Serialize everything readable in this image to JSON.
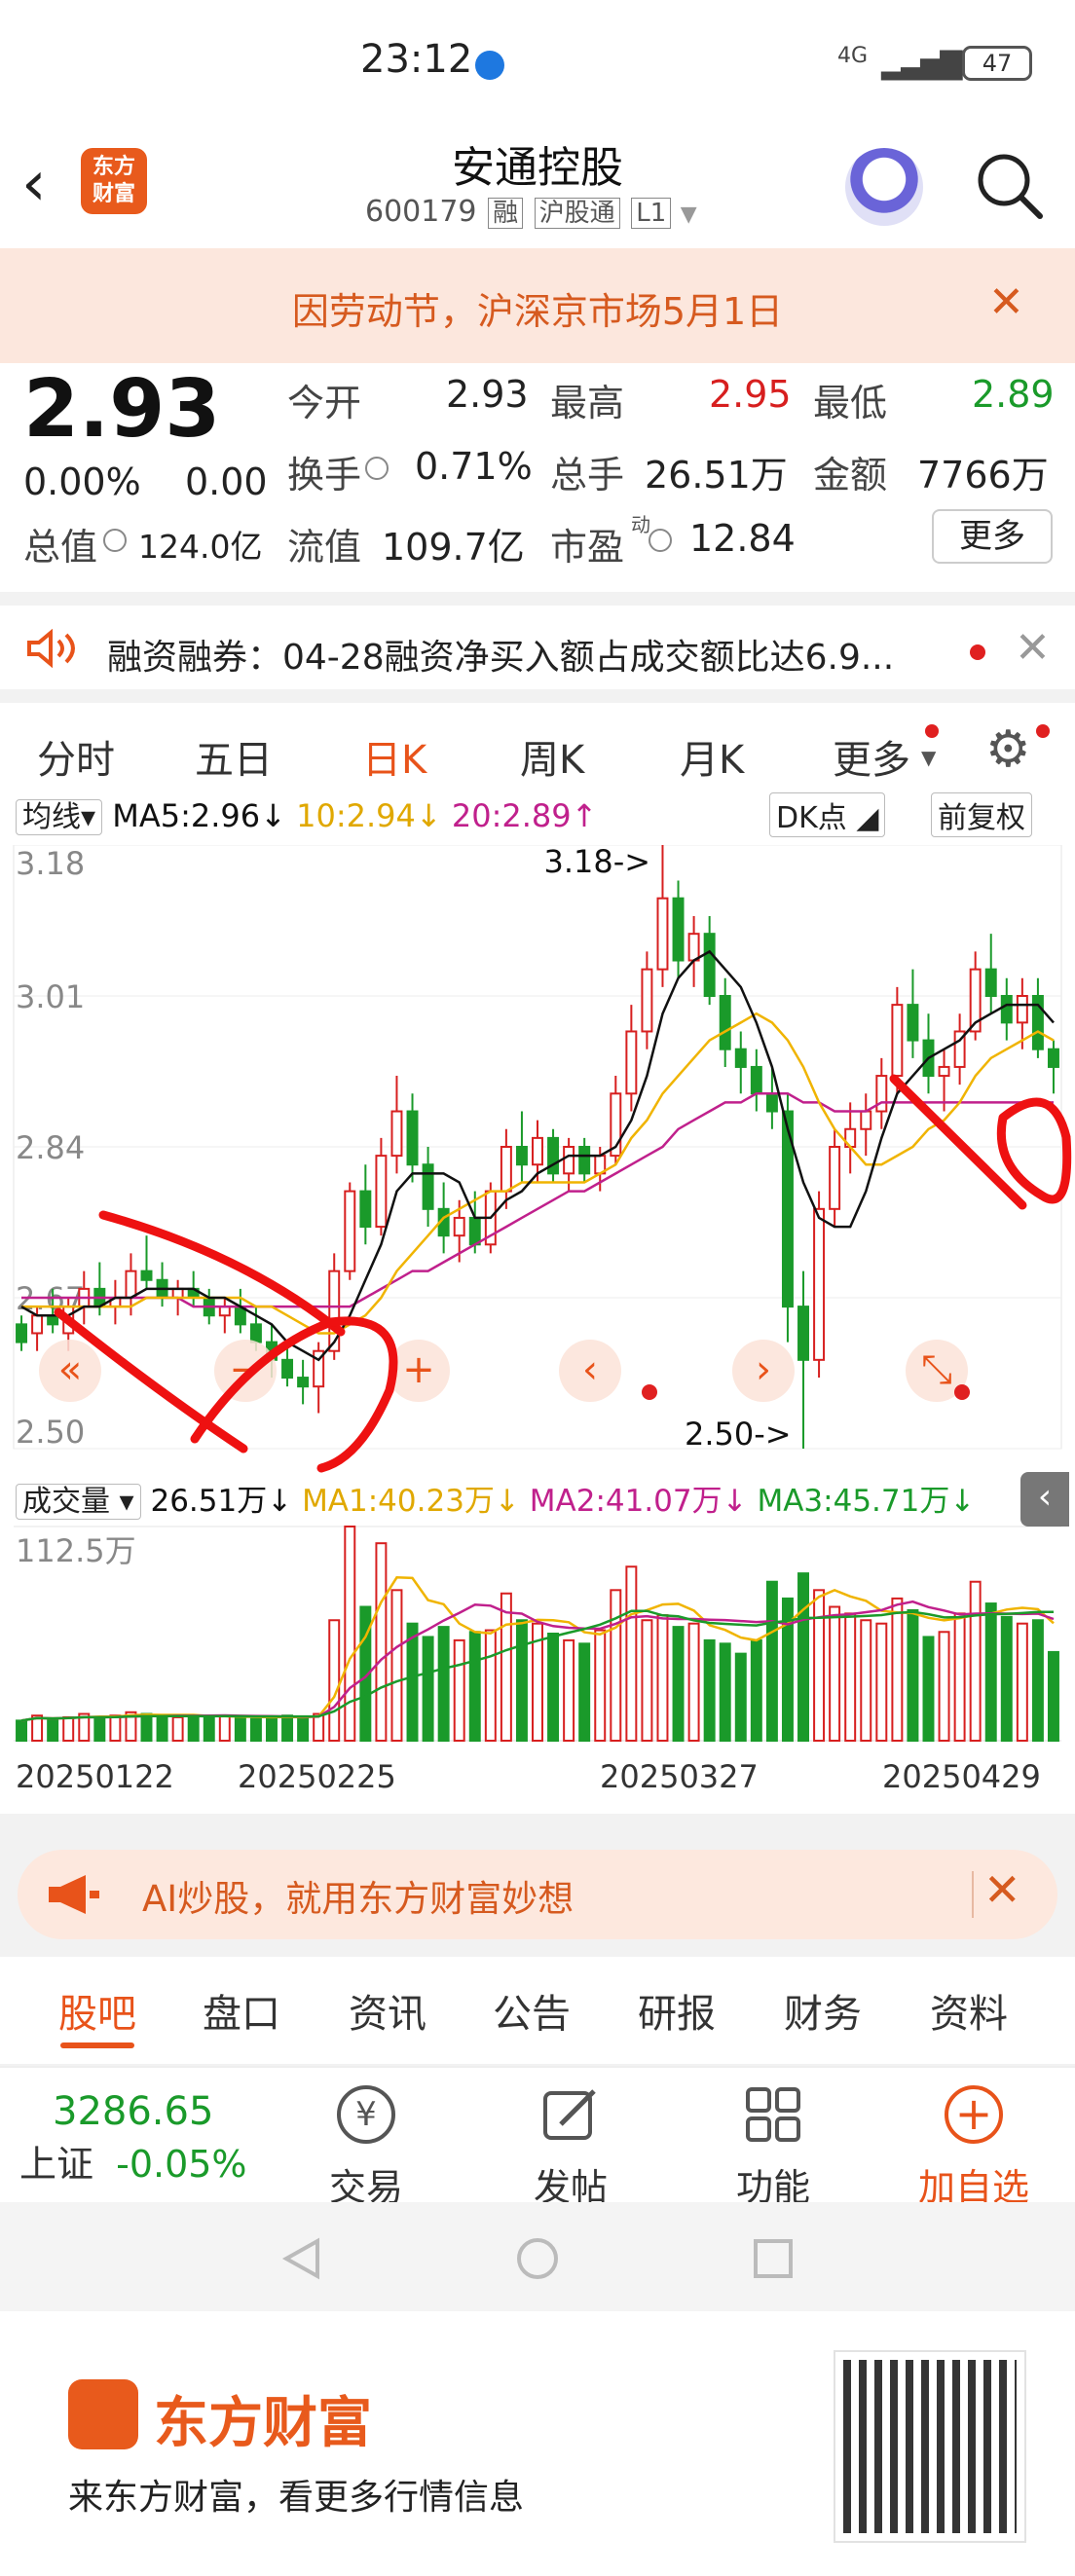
{
  "status": {
    "time": "23:12",
    "network": "4G",
    "battery": "47"
  },
  "header": {
    "logo_line1": "东方",
    "logo_line2": "财富",
    "title": "安通控股",
    "code": "600179",
    "tags": [
      "融",
      "沪股通",
      "L1"
    ]
  },
  "notice": {
    "text": "因劳动节，沪深京市场5月1日"
  },
  "quote": {
    "price": "2.93",
    "change_pct": "0.00%",
    "change": "0.00",
    "open_label": "今开",
    "open": "2.93",
    "high_label": "最高",
    "high": "2.95",
    "low_label": "最低",
    "low": "2.89",
    "turnover_label": "换手",
    "turnover": "0.71%",
    "volume_label": "总手",
    "volume": "26.51万",
    "amount_label": "金额",
    "amount": "7766万",
    "mcap_label": "总值",
    "mcap": "124.0亿",
    "float_label": "流值",
    "float": "109.7亿",
    "pe_label": "市盈",
    "pe_sup": "动",
    "pe": "12.84",
    "more": "更多"
  },
  "margin": {
    "text": "融资融券：04-28融资净买入额占成交额比达6.9..."
  },
  "tabs": [
    "分时",
    "五日",
    "日K",
    "周K",
    "月K",
    "更多"
  ],
  "active_tab": "日K",
  "chart_header": {
    "ma_select": "均线",
    "ma5": "MA5:2.96↓",
    "ma10": "10:2.94↓",
    "ma20": "20:2.89↑",
    "dk": "DK点",
    "adjust": "前复权"
  },
  "price_axis": [
    "3.18",
    "3.01",
    "2.84",
    "2.67",
    "2.50"
  ],
  "annotations": {
    "max": "3.18->",
    "min": "2.50->"
  },
  "vol_header": {
    "select": "成交量",
    "vol": "26.51万↓",
    "ma1": "MA1:40.23万↓",
    "ma2": "MA2:41.07万↓",
    "ma3": "MA3:45.71万↓"
  },
  "vol_axis": "112.5万",
  "dates": [
    "20250122",
    "20250225",
    "20250327",
    "20250429"
  ],
  "colors": {
    "up": "#d71f1f",
    "down": "#1a9a2a",
    "accent": "#e8531a",
    "ma5": "#111111",
    "ma10": "#f0b400",
    "ma20": "#c0208c"
  },
  "chart_data": {
    "type": "candlestick",
    "ylim": [
      2.5,
      3.18
    ],
    "candles": [
      [
        2.64,
        2.65,
        2.61,
        2.62
      ],
      [
        2.63,
        2.66,
        2.61,
        2.65
      ],
      [
        2.65,
        2.68,
        2.63,
        2.64
      ],
      [
        2.63,
        2.67,
        2.61,
        2.66
      ],
      [
        2.66,
        2.7,
        2.64,
        2.68
      ],
      [
        2.68,
        2.71,
        2.65,
        2.66
      ],
      [
        2.66,
        2.69,
        2.64,
        2.67
      ],
      [
        2.67,
        2.72,
        2.65,
        2.7
      ],
      [
        2.7,
        2.74,
        2.68,
        2.69
      ],
      [
        2.69,
        2.71,
        2.66,
        2.67
      ],
      [
        2.67,
        2.69,
        2.65,
        2.68
      ],
      [
        2.68,
        2.7,
        2.66,
        2.67
      ],
      [
        2.67,
        2.68,
        2.64,
        2.65
      ],
      [
        2.65,
        2.67,
        2.63,
        2.66
      ],
      [
        2.66,
        2.68,
        2.63,
        2.64
      ],
      [
        2.64,
        2.66,
        2.61,
        2.62
      ],
      [
        2.62,
        2.64,
        2.58,
        2.6
      ],
      [
        2.6,
        2.62,
        2.57,
        2.58
      ],
      [
        2.58,
        2.6,
        2.55,
        2.57
      ],
      [
        2.57,
        2.62,
        2.54,
        2.61
      ],
      [
        2.61,
        2.72,
        2.6,
        2.7
      ],
      [
        2.7,
        2.8,
        2.69,
        2.79
      ],
      [
        2.79,
        2.82,
        2.73,
        2.75
      ],
      [
        2.75,
        2.85,
        2.74,
        2.83
      ],
      [
        2.83,
        2.92,
        2.81,
        2.88
      ],
      [
        2.88,
        2.9,
        2.8,
        2.82
      ],
      [
        2.82,
        2.84,
        2.75,
        2.77
      ],
      [
        2.77,
        2.8,
        2.72,
        2.74
      ],
      [
        2.74,
        2.78,
        2.71,
        2.76
      ],
      [
        2.76,
        2.79,
        2.72,
        2.73
      ],
      [
        2.73,
        2.8,
        2.72,
        2.79
      ],
      [
        2.79,
        2.86,
        2.77,
        2.84
      ],
      [
        2.84,
        2.88,
        2.8,
        2.82
      ],
      [
        2.82,
        2.87,
        2.8,
        2.85
      ],
      [
        2.85,
        2.86,
        2.8,
        2.81
      ],
      [
        2.81,
        2.85,
        2.79,
        2.84
      ],
      [
        2.84,
        2.85,
        2.8,
        2.81
      ],
      [
        2.81,
        2.84,
        2.79,
        2.83
      ],
      [
        2.83,
        2.92,
        2.82,
        2.9
      ],
      [
        2.9,
        3.0,
        2.88,
        2.97
      ],
      [
        2.97,
        3.06,
        2.95,
        3.04
      ],
      [
        3.04,
        3.18,
        3.02,
        3.12
      ],
      [
        3.12,
        3.14,
        3.03,
        3.05
      ],
      [
        3.05,
        3.1,
        3.02,
        3.08
      ],
      [
        3.08,
        3.1,
        3.0,
        3.01
      ],
      [
        3.01,
        3.03,
        2.93,
        2.95
      ],
      [
        2.95,
        2.97,
        2.9,
        2.93
      ],
      [
        2.93,
        2.95,
        2.88,
        2.9
      ],
      [
        2.9,
        2.93,
        2.86,
        2.88
      ],
      [
        2.88,
        2.9,
        2.62,
        2.66
      ],
      [
        2.66,
        2.7,
        2.5,
        2.6
      ],
      [
        2.6,
        2.79,
        2.58,
        2.77
      ],
      [
        2.77,
        2.86,
        2.75,
        2.84
      ],
      [
        2.84,
        2.89,
        2.81,
        2.86
      ],
      [
        2.86,
        2.9,
        2.83,
        2.88
      ],
      [
        2.88,
        2.94,
        2.86,
        2.92
      ],
      [
        2.92,
        3.02,
        2.9,
        3.0
      ],
      [
        3.0,
        3.04,
        2.94,
        2.96
      ],
      [
        2.96,
        2.99,
        2.9,
        2.92
      ],
      [
        2.92,
        2.95,
        2.88,
        2.93
      ],
      [
        2.93,
        2.99,
        2.91,
        2.97
      ],
      [
        2.97,
        3.06,
        2.96,
        3.04
      ],
      [
        3.04,
        3.08,
        2.99,
        3.01
      ],
      [
        3.01,
        3.03,
        2.96,
        2.98
      ],
      [
        2.98,
        3.03,
        2.95,
        3.01
      ],
      [
        3.01,
        3.03,
        2.94,
        2.95
      ],
      [
        2.95,
        2.96,
        2.9,
        2.93
      ]
    ],
    "volumes": [
      12,
      15,
      13,
      14,
      16,
      14,
      15,
      17,
      16,
      15,
      14,
      15,
      14,
      15,
      14,
      13,
      14,
      15,
      14,
      16,
      72,
      128,
      80,
      118,
      90,
      70,
      62,
      68,
      60,
      65,
      66,
      88,
      72,
      70,
      64,
      60,
      58,
      66,
      90,
      104,
      72,
      75,
      68,
      70,
      60,
      58,
      52,
      60,
      95,
      85,
      100,
      90,
      80,
      76,
      72,
      70,
      85,
      78,
      62,
      65,
      76,
      95,
      82,
      74,
      70,
      72,
      53
    ],
    "ma5": [
      2.66,
      2.65,
      2.65,
      2.65,
      2.66,
      2.66,
      2.67,
      2.67,
      2.68,
      2.68,
      2.68,
      2.68,
      2.67,
      2.67,
      2.66,
      2.65,
      2.64,
      2.62,
      2.61,
      2.6,
      2.62,
      2.65,
      2.69,
      2.73,
      2.79,
      2.81,
      2.81,
      2.81,
      2.8,
      2.76,
      2.76,
      2.78,
      2.79,
      2.81,
      2.82,
      2.83,
      2.83,
      2.83,
      2.84,
      2.87,
      2.92,
      2.99,
      3.03,
      3.05,
      3.06,
      3.04,
      3.02,
      2.98,
      2.93,
      2.86,
      2.8,
      2.76,
      2.75,
      2.75,
      2.79,
      2.85,
      2.9,
      2.92,
      2.94,
      2.95,
      2.96,
      2.98,
      2.99,
      3.0,
      3.0,
      3.0,
      2.98
    ],
    "ma10": [
      2.66,
      2.66,
      2.66,
      2.66,
      2.66,
      2.66,
      2.66,
      2.66,
      2.67,
      2.67,
      2.67,
      2.67,
      2.67,
      2.67,
      2.67,
      2.66,
      2.66,
      2.65,
      2.64,
      2.63,
      2.63,
      2.64,
      2.65,
      2.67,
      2.7,
      2.72,
      2.74,
      2.76,
      2.77,
      2.78,
      2.79,
      2.79,
      2.8,
      2.8,
      2.8,
      2.8,
      2.8,
      2.81,
      2.82,
      2.85,
      2.87,
      2.9,
      2.92,
      2.94,
      2.96,
      2.97,
      2.98,
      2.99,
      2.98,
      2.96,
      2.93,
      2.89,
      2.86,
      2.84,
      2.82,
      2.82,
      2.83,
      2.84,
      2.86,
      2.87,
      2.89,
      2.92,
      2.94,
      2.95,
      2.96,
      2.97,
      2.96
    ],
    "ma20": [
      2.67,
      2.67,
      2.67,
      2.67,
      2.67,
      2.67,
      2.67,
      2.67,
      2.67,
      2.67,
      2.67,
      2.66,
      2.66,
      2.66,
      2.66,
      2.66,
      2.66,
      2.66,
      2.66,
      2.66,
      2.66,
      2.66,
      2.67,
      2.68,
      2.69,
      2.7,
      2.7,
      2.71,
      2.72,
      2.73,
      2.74,
      2.75,
      2.76,
      2.77,
      2.78,
      2.79,
      2.79,
      2.8,
      2.81,
      2.82,
      2.83,
      2.84,
      2.86,
      2.87,
      2.88,
      2.89,
      2.89,
      2.9,
      2.9,
      2.9,
      2.89,
      2.89,
      2.88,
      2.88,
      2.88,
      2.89,
      2.89,
      2.89,
      2.89,
      2.89,
      2.89,
      2.89,
      2.89,
      2.89,
      2.89,
      2.89,
      2.89
    ]
  },
  "ai_banner": {
    "text": "AI炒股，就用东方财富妙想"
  },
  "sub_tabs": [
    "股吧",
    "盘口",
    "资讯",
    "公告",
    "研报",
    "财务",
    "资料"
  ],
  "index": {
    "value": "3286.65",
    "name": "上证",
    "change": "-0.05%"
  },
  "bottom_nav": [
    {
      "label": "交易",
      "icon": "yen-icon"
    },
    {
      "label": "发帖",
      "icon": "edit-icon"
    },
    {
      "label": "功能",
      "icon": "grid-icon"
    },
    {
      "label": "加自选",
      "icon": "plus-circle-icon"
    }
  ],
  "promo": {
    "brand": "东方财富",
    "slogan": "来东方财富，看更多行情信息"
  }
}
